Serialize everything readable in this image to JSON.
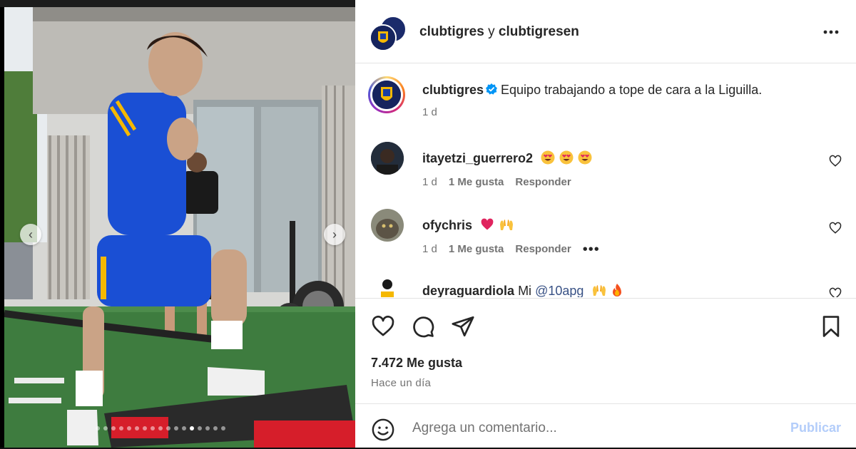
{
  "post": {
    "header": {
      "user_primary": "clubtigres",
      "separator": "y",
      "user_secondary": "clubtigresen"
    },
    "caption": {
      "username": "clubtigres",
      "text": "Equipo trabajando a tope de cara a la Liguilla.",
      "time": "1 d"
    },
    "comments": [
      {
        "username": "itayetzi_guerrero2",
        "text": "",
        "emojis": [
          "😍",
          "😍",
          "😍"
        ],
        "time": "1 d",
        "likes": "1 Me gusta",
        "reply": "Responder"
      },
      {
        "username": "ofychris",
        "text": "",
        "emojis": [
          "❤️",
          "🙌"
        ],
        "time": "1 d",
        "likes": "1 Me gusta",
        "reply": "Responder"
      },
      {
        "username": "deyraguardiola",
        "text": "Mi",
        "mention": "@10apg",
        "emojis": [
          "🙌",
          "🔥"
        ]
      }
    ],
    "likes_count": "7.472 Me gusta",
    "timestamp": "Hace un día",
    "composer": {
      "placeholder": "Agrega un comentario...",
      "publish_label": "Publicar"
    },
    "carousel": {
      "slide_count": 17,
      "active_index": 12
    }
  },
  "colors": {
    "brand_blue": "#0f4fd6",
    "link_blue": "#385185",
    "publish_disabled": "#b3cdfa",
    "secondary_text": "#737373"
  }
}
